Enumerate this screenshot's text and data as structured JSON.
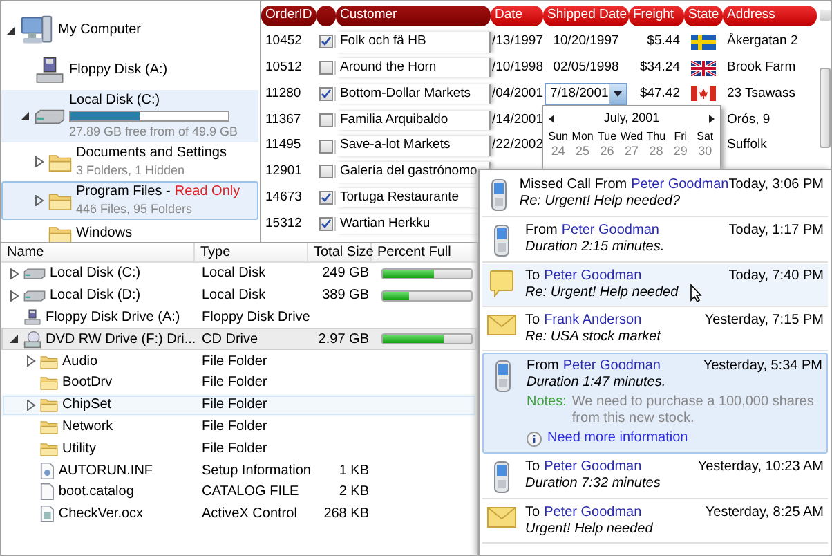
{
  "tree": {
    "items": [
      {
        "kind": "computer",
        "label": "My Computer",
        "expanded": true,
        "selected": false,
        "hot": false,
        "children": [
          {
            "kind": "floppy",
            "label": "Floppy Disk (A:)",
            "selected": false,
            "hot": false
          },
          {
            "kind": "disk",
            "label": "Local Disk (C:)",
            "expanded": true,
            "selected": false,
            "hot": true,
            "level": 0.44,
            "detail": "27.89 GB free from of 49.9 GB",
            "children": [
              {
                "kind": "folder",
                "label": "Documents and Settings",
                "detail": "3 Folders, 1 Hidden",
                "expanded": false,
                "selected": false,
                "hot": false
              },
              {
                "kind": "folder",
                "label": "Program Files -",
                "badge": "Read Only",
                "detail": "446 Files, 95 Folders",
                "expanded": false,
                "selected": true,
                "hot": true
              },
              {
                "kind": "folder",
                "label": "Windows",
                "selected": false,
                "hot": false
              }
            ]
          }
        ]
      }
    ]
  },
  "grid": {
    "columns": [
      {
        "label": "OrderID",
        "frozen": true
      },
      {
        "frozen": true
      },
      {
        "label": "Customer",
        "frozen": true
      },
      {
        "label": "Date",
        "frozen": false
      },
      {
        "label": "Shipped Date",
        "frozen": false
      },
      {
        "label": "Freight",
        "frozen": false
      },
      {
        "label": "State",
        "frozen": false
      },
      {
        "label": "Address",
        "frozen": false
      }
    ],
    "rows": [
      {
        "kind": "sweden",
        "order_id": "10452",
        "checked": true,
        "customer": "Folk och fä HB",
        "date": "/13/1997",
        "shipped": "10/20/1997",
        "editing": false,
        "freight": "$5.44",
        "address": "Åkergatan 2"
      },
      {
        "kind": "uk",
        "order_id": "10512",
        "checked": false,
        "customer": "Around the Horn",
        "date": "/10/1998",
        "shipped": "02/05/1998",
        "editing": false,
        "freight": "$34.24",
        "address": "Brook Farm"
      },
      {
        "kind": "canada",
        "order_id": "11280",
        "checked": true,
        "customer": "Bottom-Dollar Markets",
        "date": "/04/2001",
        "shipped": "7/18/2001",
        "editing": true,
        "freight": "$47.42",
        "address": "23 Tsawass"
      },
      {
        "kind": "none",
        "order_id": "11367",
        "checked": false,
        "customer": "Familia Arquibaldo",
        "date": "/14/2001",
        "address": "Orós, 9"
      },
      {
        "kind": "none",
        "order_id": "11495",
        "checked": false,
        "customer": "Save-a-lot Markets",
        "date": "/22/2002",
        "address": "Suffolk"
      },
      {
        "kind": "none",
        "order_id": "12901",
        "checked": false,
        "customer": "Galería del gastrónomo"
      },
      {
        "kind": "none",
        "order_id": "14673",
        "checked": true,
        "customer": "Tortuga Restaurante"
      },
      {
        "kind": "none",
        "order_id": "15312",
        "checked": true,
        "customer": "Wartian Herkku"
      }
    ]
  },
  "calendar": {
    "month": "July, 2001",
    "weekdays": [
      "Sun",
      "Mon",
      "Tue",
      "Wed",
      "Thu",
      "Fri",
      "Sat"
    ],
    "days": [
      "24",
      "25",
      "26",
      "27",
      "28",
      "29",
      "30"
    ]
  },
  "file_list": {
    "columns": [
      "Name",
      "Type",
      "Total Size",
      "Percent Full"
    ],
    "rows": [
      {
        "kind": "disk",
        "name": "Local Disk (C:)",
        "type": "Local Disk",
        "size": "249 GB",
        "level": 0.58,
        "expanded": false,
        "selected": false,
        "hovered": false
      },
      {
        "kind": "disk",
        "name": "Local Disk (D:)",
        "type": "Local Disk",
        "size": "389 GB",
        "level": 0.3,
        "expanded": false,
        "selected": false,
        "hovered": false
      },
      {
        "kind": "floppy",
        "name": "Floppy Disk Drive (A:)",
        "type": "Floppy Disk Drive",
        "selected": false,
        "hovered": false
      },
      {
        "kind": "dvd",
        "name": "DVD RW Drive (F:) Dri...",
        "type": "CD Drive",
        "size": "2.97 GB",
        "level": 0.68,
        "expanded": true,
        "selected": true,
        "hovered": false,
        "children": [
          {
            "kind": "folder",
            "name": "Audio",
            "type": "File Folder",
            "expanded": false,
            "selected": false,
            "hovered": false
          },
          {
            "kind": "folder",
            "name": "BootDrv",
            "type": "File Folder",
            "selected": false,
            "hovered": false
          },
          {
            "kind": "folder",
            "name": "ChipSet",
            "type": "File Folder",
            "expanded": false,
            "selected": false,
            "hovered": true
          },
          {
            "kind": "folder",
            "name": "Network",
            "type": "File Folder",
            "selected": false,
            "hovered": false
          },
          {
            "kind": "folder",
            "name": "Utility",
            "type": "File Folder",
            "selected": false,
            "hovered": false
          },
          {
            "kind": "setup",
            "name": "AUTORUN.INF",
            "type": "Setup Information",
            "size": "1 KB",
            "selected": false,
            "hovered": false
          },
          {
            "kind": "document",
            "name": "boot.catalog",
            "type": "CATALOG FILE",
            "size": "2 KB",
            "selected": false,
            "hovered": false
          },
          {
            "kind": "component",
            "name": "CheckVer.ocx",
            "type": "ActiveX Control",
            "size": "268 KB",
            "selected": false,
            "hovered": false
          }
        ]
      }
    ]
  },
  "messages": [
    {
      "kind": "phone",
      "prefix": "Missed Call From",
      "contact": "Peter Goodman",
      "time": "Today, 3:06 PM",
      "detail": "Re: Urgent! Help needed?",
      "selected": false,
      "hovered": false
    },
    {
      "kind": "phone",
      "prefix": "From",
      "contact": "Peter Goodman",
      "time": "Today, 1:17 PM",
      "detail": "Duration 2:15 minutes.",
      "selected": false,
      "hovered": false
    },
    {
      "kind": "note",
      "prefix": "To",
      "contact": "Peter Goodman",
      "time": "Today, 7:40 PM",
      "detail": "Re: Urgent! Help needed",
      "selected": false,
      "hovered": true
    },
    {
      "kind": "mail",
      "prefix": "To",
      "contact": "Frank Anderson",
      "time": "Yesterday, 7:15 PM",
      "detail": "Re: USA stock market",
      "selected": false,
      "hovered": false
    },
    {
      "kind": "phone",
      "prefix": "From",
      "contact": "Peter Goodman",
      "time": "Yesterday, 5:34 PM",
      "detail": "Duration 1:47 minutes.",
      "selected": true,
      "hovered": false,
      "notes_label": "Notes:",
      "notes": "We need to purchase a 100,000 shares from this new stock.",
      "link": "Need more information"
    },
    {
      "kind": "phone",
      "prefix": "To",
      "contact": "Peter Goodman",
      "time": "Yesterday, 10:23 AM",
      "detail": "Duration 7:32 minutes",
      "selected": false,
      "hovered": false
    },
    {
      "kind": "mail",
      "prefix": "To",
      "contact": "Peter Goodman",
      "time": "Yesterday, 8:25 AM",
      "detail": "Urgent! Help needed",
      "selected": false,
      "hovered": false
    }
  ]
}
